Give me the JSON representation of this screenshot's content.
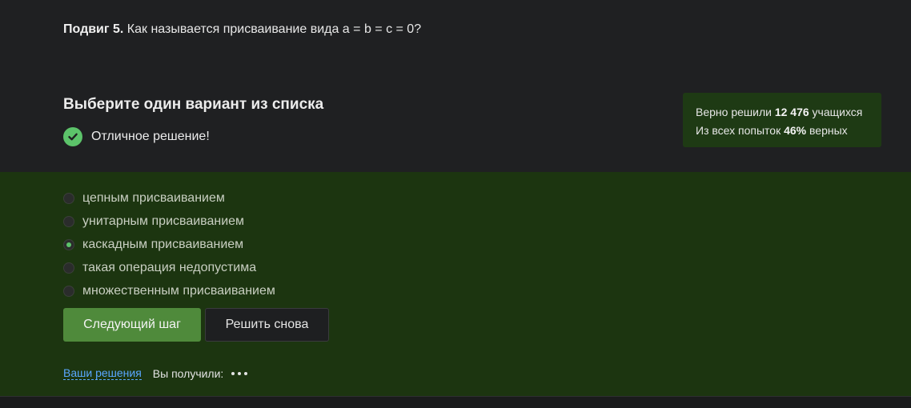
{
  "question": {
    "label": "Подвиг 5.",
    "text": "Как называется присваивание вида a = b = c = 0?"
  },
  "task": {
    "title": "Выберите один вариант из списка",
    "feedback": "Отличное решение!"
  },
  "stats": {
    "line1_prefix": "Верно решили",
    "solved_count": "12 476",
    "line1_suffix": "учащихся",
    "line2_prefix": "Из всех попыток",
    "percent": "46%",
    "line2_suffix": "верных"
  },
  "options": [
    {
      "label": "цепным присваиванием",
      "selected": false
    },
    {
      "label": "унитарным присваиванием",
      "selected": false
    },
    {
      "label": "каскадным присваиванием",
      "selected": true
    },
    {
      "label": "такая операция недопустима",
      "selected": false
    },
    {
      "label": "множественным присваиванием",
      "selected": false
    }
  ],
  "buttons": {
    "next": "Следующий шаг",
    "retry": "Решить снова"
  },
  "footer": {
    "your_solutions": "Ваши решения",
    "you_got": "Вы получили:"
  },
  "colors": {
    "accent_green": "#5cc36a",
    "answer_bg": "#1c3510",
    "link_blue": "#5aa7ff"
  }
}
